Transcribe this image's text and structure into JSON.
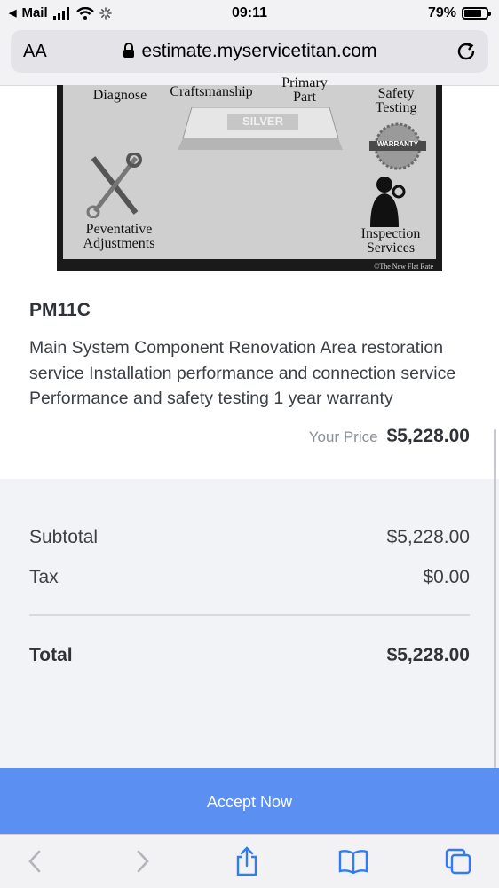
{
  "status_bar": {
    "back_app": "Mail",
    "time": "09:11",
    "battery": "79%",
    "battery_level": 0.79
  },
  "browser": {
    "text_size_button": "AA",
    "url": "estimate.myservicetitan.com"
  },
  "product_image": {
    "labels": {
      "diagnose": "Diagnose",
      "craftsmanship": "Craftsmanship",
      "primary_part": "Primary Part",
      "safety_testing": "Safety Testing",
      "silver": "SILVER",
      "warranty": "WARRANTY",
      "preventative": "Peventative Adjustments",
      "inspection": "Inspection Services",
      "credit": "©The New Flat Rate"
    }
  },
  "item": {
    "code": "PM11C",
    "description": "Main System Component Renovation Area restoration service Installation performance and connection service Performance and safety testing 1 year warranty",
    "price_label": "Your Price",
    "price": "$5,228.00"
  },
  "summary": {
    "subtotal_label": "Subtotal",
    "subtotal": "$5,228.00",
    "tax_label": "Tax",
    "tax": "$0.00",
    "total_label": "Total",
    "total": "$5,228.00"
  },
  "actions": {
    "accept": "Accept Now"
  },
  "toolbar": {
    "icons": [
      "back-icon",
      "forward-icon",
      "share-icon",
      "bookmarks-icon",
      "tabs-icon"
    ]
  },
  "colors": {
    "accent": "#5b8ff1",
    "summary_bg": "#f1f3f6",
    "ios_blue": "#2f7cf6"
  }
}
